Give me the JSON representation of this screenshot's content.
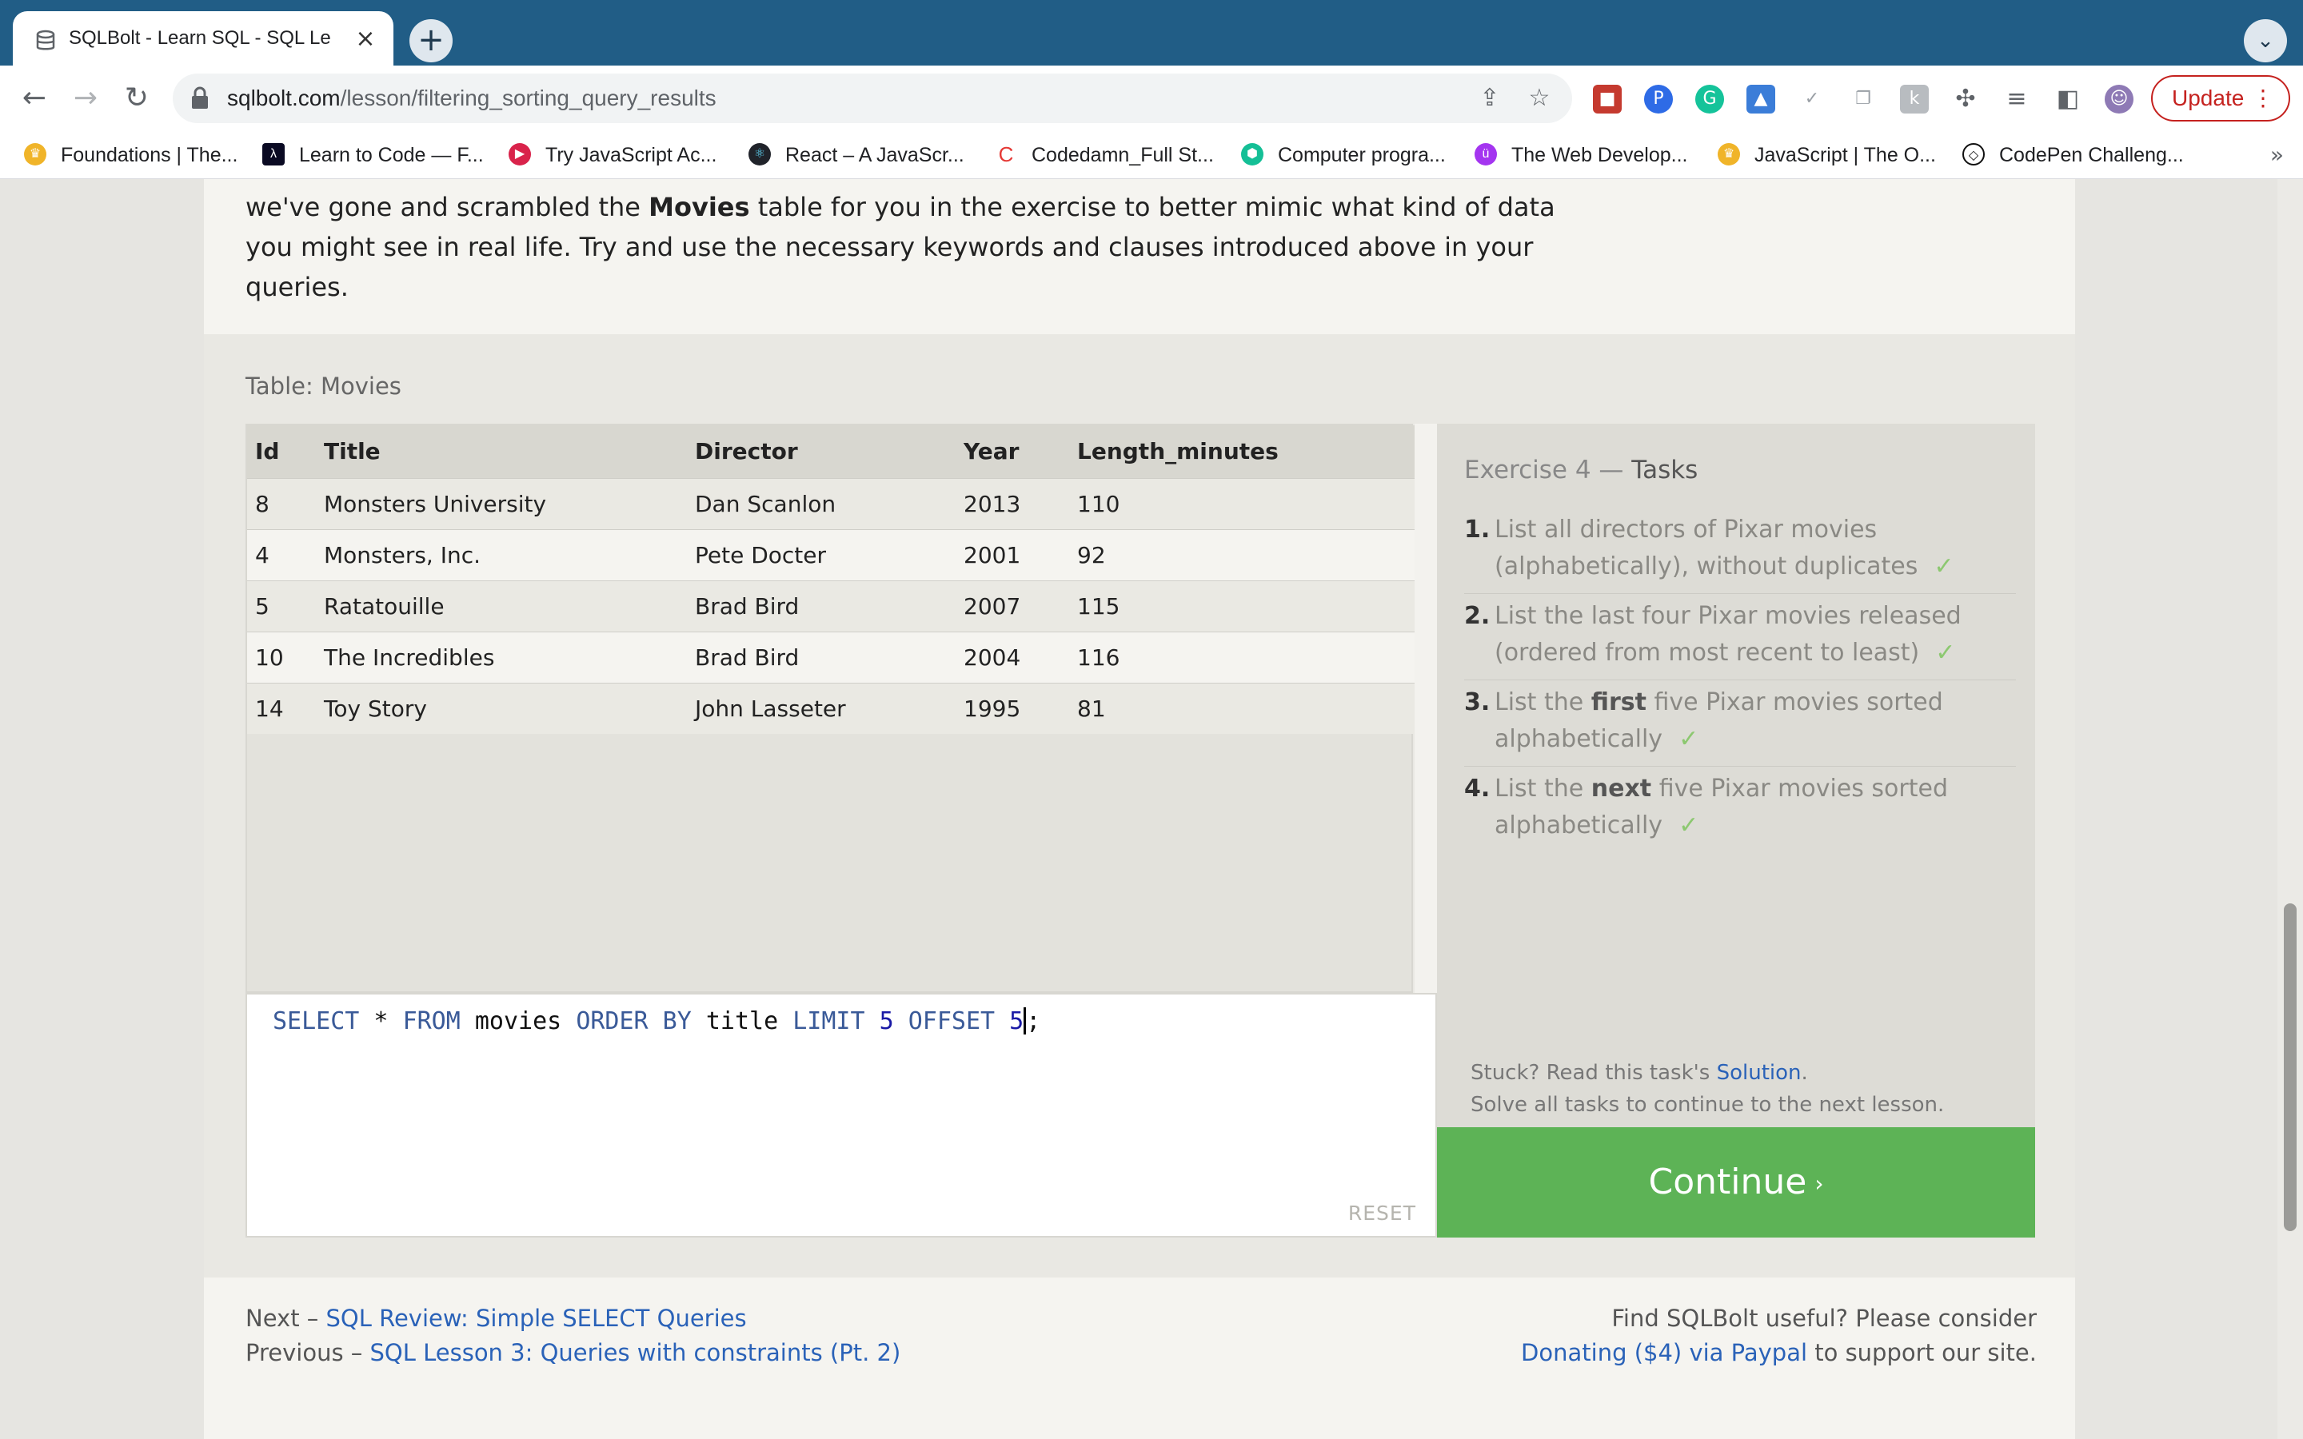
{
  "browser": {
    "tab_title": "SQLBolt - Learn SQL - SQL Le",
    "url_host": "sqlbolt.com",
    "url_path": "/lesson/filtering_sorting_query_results",
    "update_label": "Update",
    "bookmarks": [
      {
        "label": "Foundations | The...",
        "icon": "odin-icon",
        "color": "#f0b429"
      },
      {
        "label": "Learn to Code — F...",
        "icon": "freecodecamp-icon",
        "color": "#0a0a23"
      },
      {
        "label": "Try JavaScript Ac...",
        "icon": "codeschool-icon",
        "color": "#d9234b"
      },
      {
        "label": "React – A JavaScr...",
        "icon": "react-icon",
        "color": "#20232a"
      },
      {
        "label": "Codedamn_Full St...",
        "icon": "codedamn-icon",
        "color": "#e53935"
      },
      {
        "label": "Computer progra...",
        "icon": "khan-icon",
        "color": "#14bf96"
      },
      {
        "label": "The Web Develop...",
        "icon": "udemy-icon",
        "color": "#a435f0"
      },
      {
        "label": "JavaScript | The O...",
        "icon": "odin-icon",
        "color": "#f0b429"
      },
      {
        "label": "CodePen Challeng...",
        "icon": "codepen-icon",
        "color": "#111111"
      }
    ]
  },
  "lesson": {
    "intro_line1_tail": "we've gone and scrambled the ",
    "intro_bold": "Movies",
    "intro_line1_rest": " table for you in the exercise to better mimic what kind of data",
    "intro_line2": "you might see in real life. Try and use the necessary keywords and clauses introduced above in your",
    "intro_line3": "queries."
  },
  "exercise": {
    "table_caption": "Table: Movies",
    "columns": [
      "Id",
      "Title",
      "Director",
      "Year",
      "Length_minutes"
    ],
    "rows": [
      [
        "8",
        "Monsters University",
        "Dan Scanlon",
        "2013",
        "110"
      ],
      [
        "4",
        "Monsters, Inc.",
        "Pete Docter",
        "2001",
        "92"
      ],
      [
        "5",
        "Ratatouille",
        "Brad Bird",
        "2007",
        "115"
      ],
      [
        "10",
        "The Incredibles",
        "Brad Bird",
        "2004",
        "116"
      ],
      [
        "14",
        "Toy Story",
        "John Lasseter",
        "1995",
        "81"
      ]
    ],
    "query": {
      "kw_select": "SELECT",
      "star": " * ",
      "kw_from": "FROM",
      "table": " movies ",
      "kw_order": "ORDER BY",
      "col": " title ",
      "kw_limit": "LIMIT",
      "limit_val": " 5 ",
      "kw_offset": "OFFSET",
      "offset_val": " 5",
      "semicolon": ";"
    },
    "reset_label": "RESET",
    "tasks_prefix": "Exercise 4 — ",
    "tasks_title": "Tasks",
    "tasks": [
      {
        "num": "1.",
        "text": "List all directors of Pixar movies (alphabetically), without duplicates",
        "check": "✓"
      },
      {
        "num": "2.",
        "text": "List the last four Pixar movies released (ordered from most recent to least)",
        "check": "✓"
      },
      {
        "num": "3.",
        "pre": "List the ",
        "bold": "first",
        "post": " five Pixar movies sorted alphabetically",
        "check": "✓"
      },
      {
        "num": "4.",
        "pre": "List the ",
        "bold": "next",
        "post": " five Pixar movies sorted alphabetically",
        "check": "✓"
      }
    ],
    "stuck_text": "Stuck? Read this task's ",
    "solution_link": "Solution",
    "stuck_end": ".",
    "solve_all": "Solve all tasks to continue to the next lesson.",
    "continue_label": "Continue",
    "continue_chevron": "›"
  },
  "footer": {
    "next_label": "Next – ",
    "next_link": "SQL Review: Simple SELECT Queries",
    "prev_label": "Previous – ",
    "prev_link": "SQL Lesson 3: Queries with constraints (Pt. 2)",
    "support_line": "Find SQLBolt useful? Please consider",
    "donate_link": "Donating ($4) via Paypal",
    "support_tail": " to support our site."
  }
}
